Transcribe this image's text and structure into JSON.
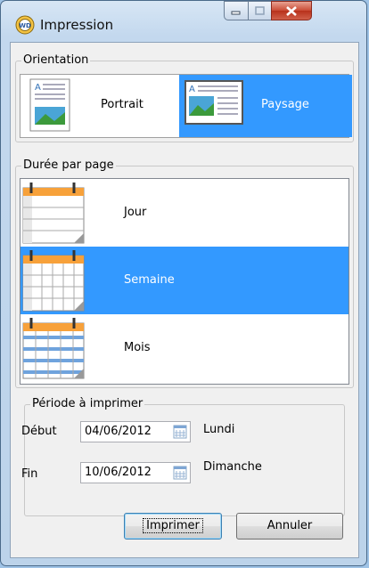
{
  "window": {
    "title": "Impression",
    "icon": "wd-print-app-icon"
  },
  "caption_buttons": {
    "minimize": "minimize-icon",
    "maximize": "maximize-icon",
    "close": "close-icon"
  },
  "orientation": {
    "legend": "Orientation",
    "options": [
      {
        "label": "Portrait",
        "selected": false
      },
      {
        "label": "Paysage",
        "selected": true
      }
    ]
  },
  "duree": {
    "legend": "Durée par page",
    "items": [
      {
        "label": "Jour",
        "selected": false
      },
      {
        "label": "Semaine",
        "selected": true
      },
      {
        "label": "Mois",
        "selected": false
      }
    ]
  },
  "periode": {
    "legend": "Période à imprimer",
    "debut": {
      "label": "Début",
      "value": "04/06/2012",
      "day": "Lundi"
    },
    "fin": {
      "label": "Fin",
      "value": "10/06/2012",
      "day": "Dimanche"
    }
  },
  "buttons": {
    "print": "Imprimer",
    "cancel": "Annuler"
  },
  "colors": {
    "selection": "#3399ff",
    "accent_orange": "#f7a13a"
  }
}
